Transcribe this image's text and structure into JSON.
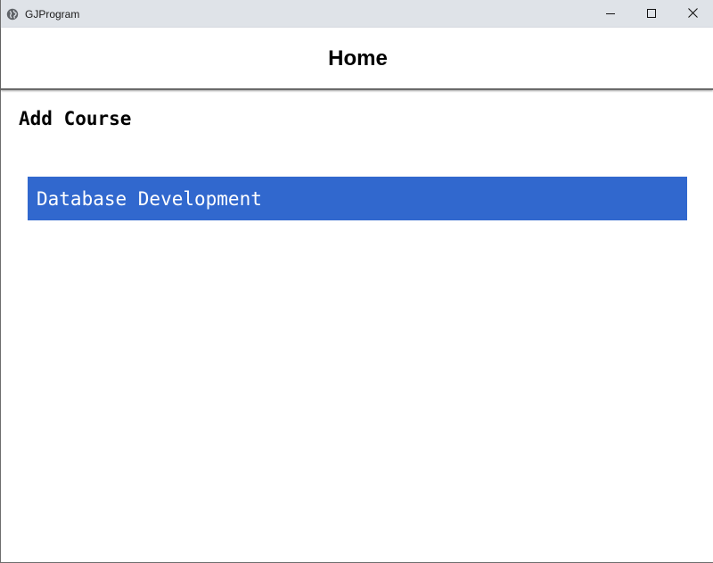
{
  "window": {
    "title": "GJProgram",
    "app_icon": "globe-icon",
    "controls": {
      "minimize_icon": "minimize-icon",
      "maximize_icon": "maximize-icon",
      "close_icon": "close-icon"
    }
  },
  "navbar": {
    "title": "Home"
  },
  "main": {
    "heading": "Add Course",
    "courses": [
      {
        "label": "Database Development",
        "selected": true
      }
    ]
  },
  "colors": {
    "titlebar_bg": "#dfe3e8",
    "selection_bg": "#3168ce",
    "selection_text": "#ffffff"
  }
}
